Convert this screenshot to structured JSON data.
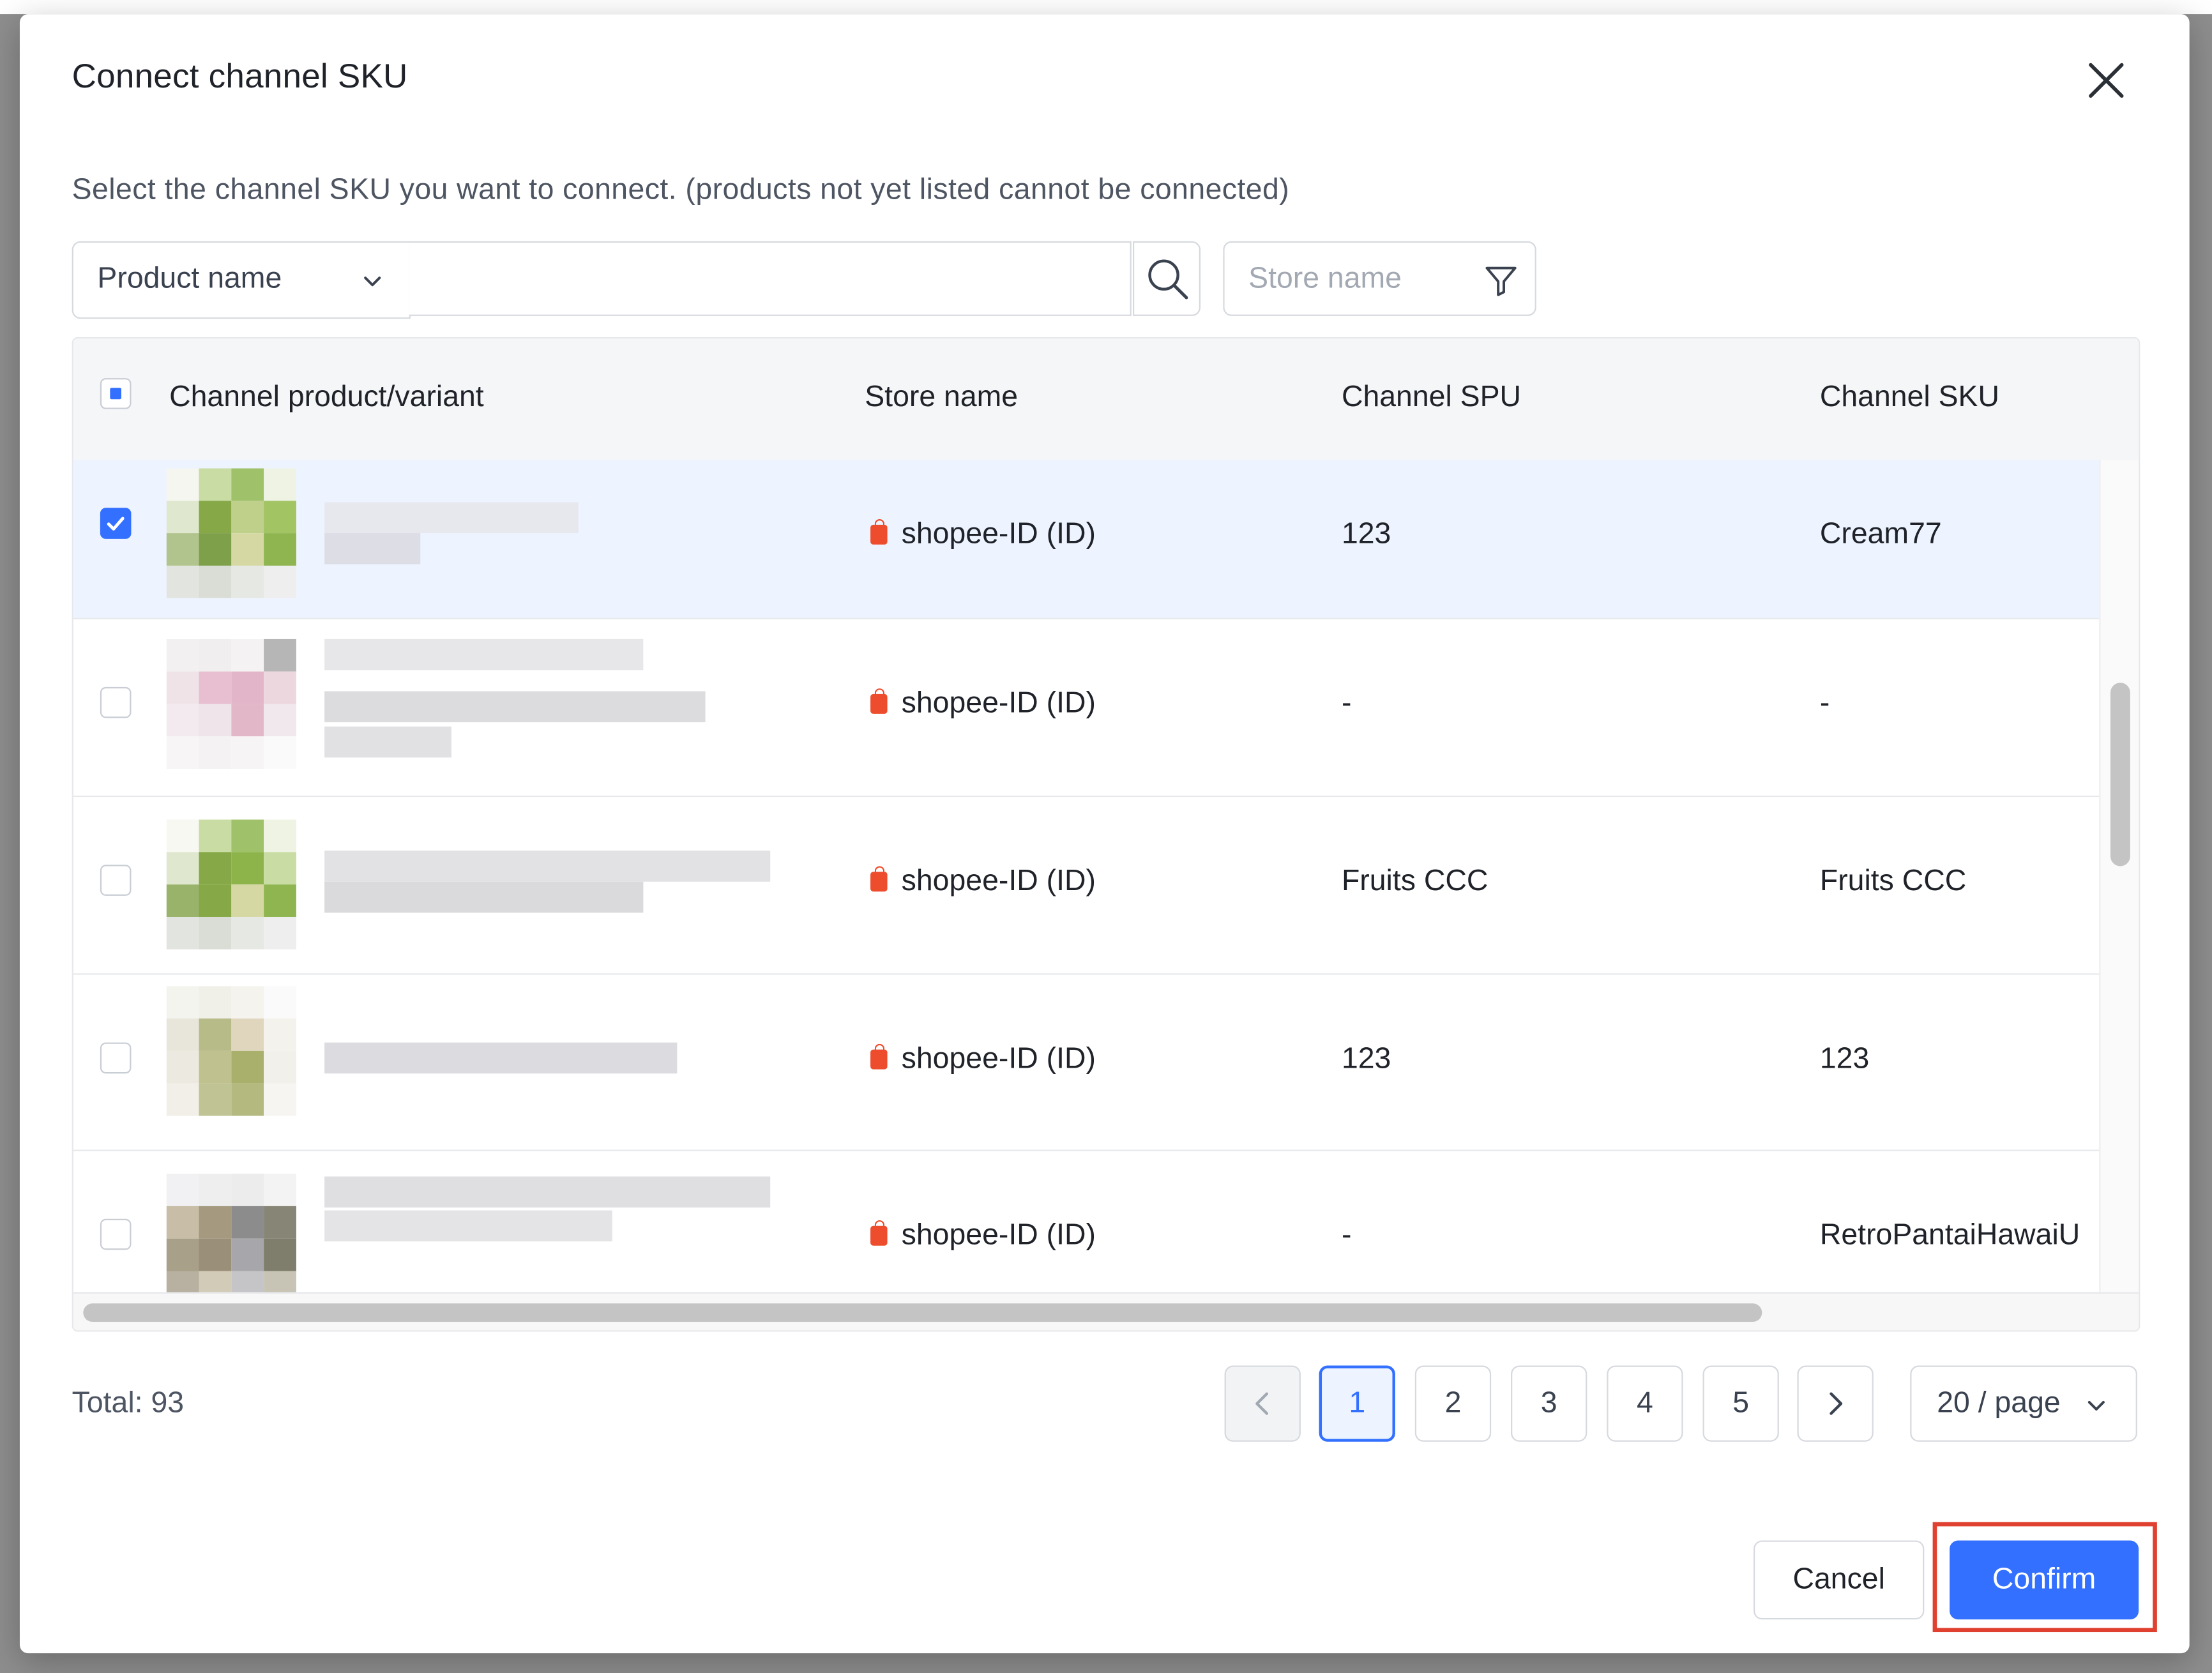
{
  "modal": {
    "title": "Connect channel SKU",
    "description": "Select the channel SKU you want to connect. (products not yet listed cannot be connected)"
  },
  "search": {
    "field_select": "Product name",
    "search_value": "",
    "store_placeholder": "Store name"
  },
  "table": {
    "columns": [
      "Channel product/variant",
      "Store name",
      "Channel SPU",
      "Channel SKU"
    ],
    "rows": [
      {
        "store": "shopee-ID (ID)",
        "spu": "123",
        "sku": "Cream77",
        "selected": true
      },
      {
        "store": "shopee-ID (ID)",
        "spu": "-",
        "sku": "-",
        "selected": false
      },
      {
        "store": "shopee-ID (ID)",
        "spu": "Fruits CCC",
        "sku": "Fruits CCC",
        "selected": false
      },
      {
        "store": "shopee-ID (ID)",
        "spu": "123",
        "sku": "123",
        "selected": false
      },
      {
        "store": "shopee-ID (ID)",
        "spu": "-",
        "sku": "RetroPantaiHawaiU",
        "selected": false
      }
    ]
  },
  "pagination": {
    "total": "Total: 93",
    "pages": [
      "1",
      "2",
      "3",
      "4",
      "5"
    ],
    "current": "1",
    "page_size": "20 / page"
  },
  "footer": {
    "cancel": "Cancel",
    "confirm": "Confirm"
  },
  "colors": {
    "primary": "#3370ff",
    "highlight_box": "#e0402f",
    "shopee": "#ee4d2d"
  }
}
